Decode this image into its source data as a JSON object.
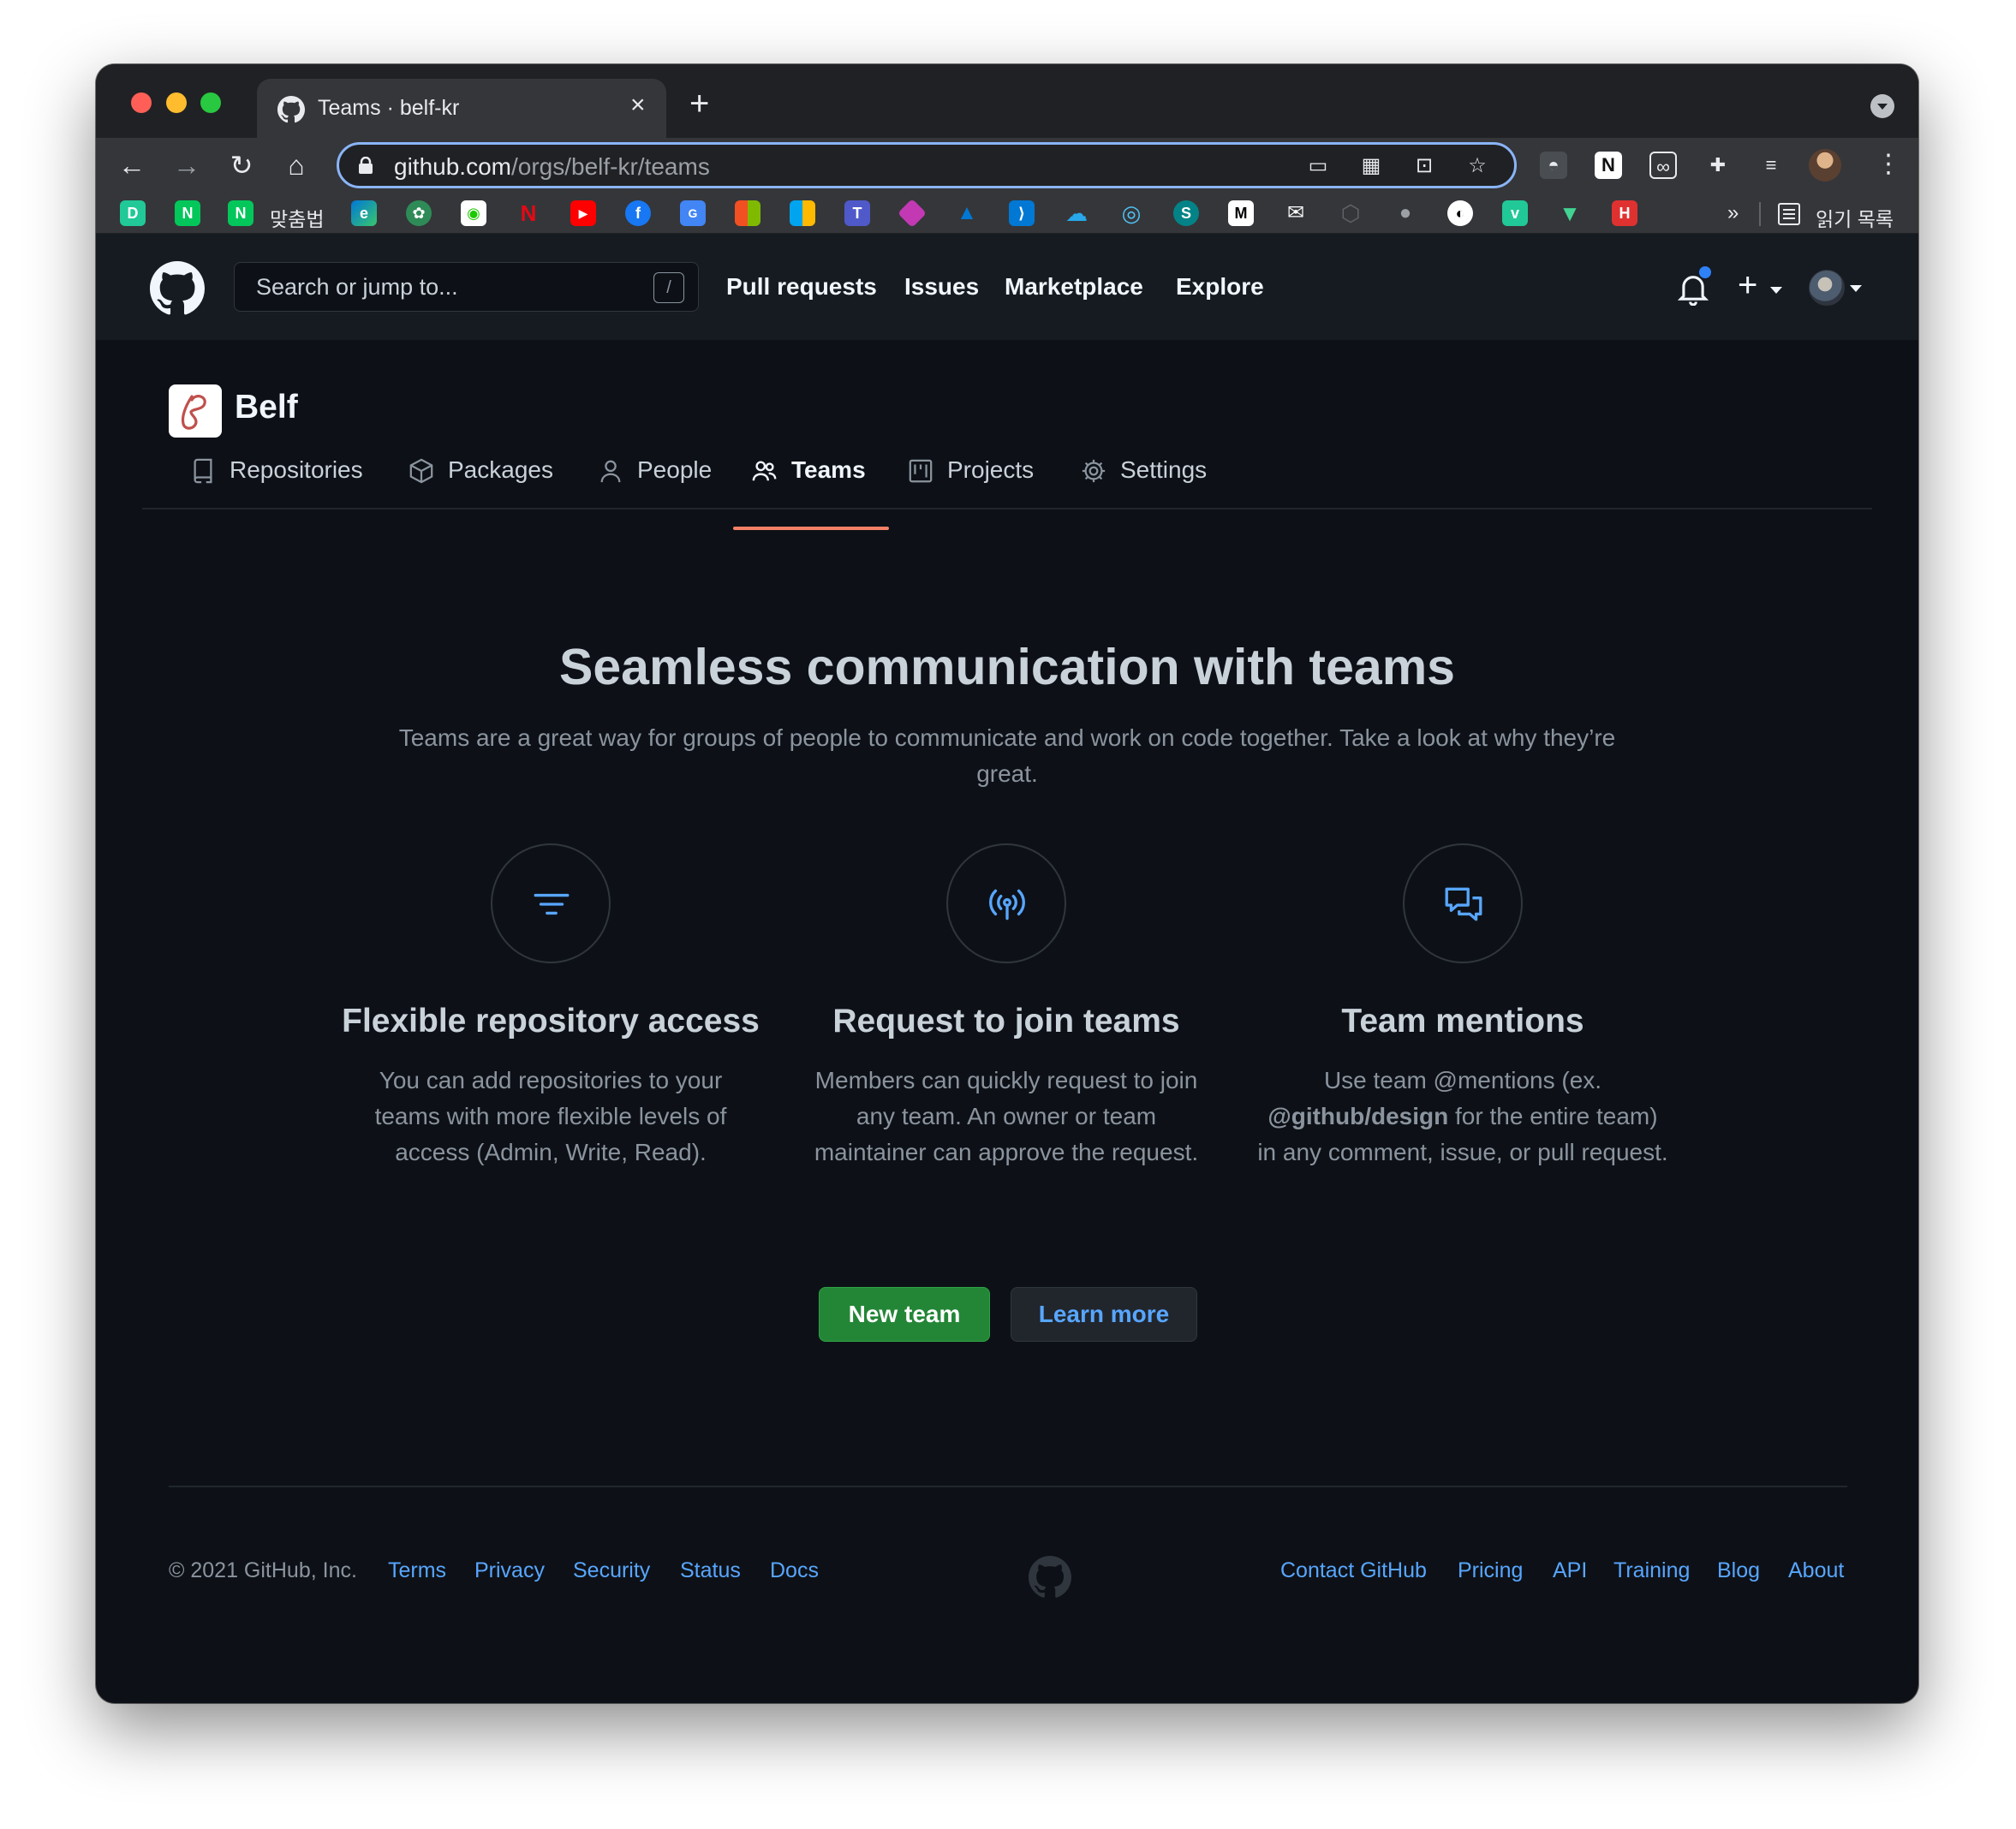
{
  "browser": {
    "tab_title": "Teams · belf-kr",
    "tab_close": "×",
    "new_tab": "+",
    "url_host": "github.com",
    "url_path": "/orgs/belf-kr/teams",
    "bookmarks": {
      "label_1": "맞춤법",
      "more": "»",
      "reading_list": "읽기 목록"
    }
  },
  "github_header": {
    "search_placeholder": "Search or jump to...",
    "search_shortcut": "/",
    "nav": [
      "Pull requests",
      "Issues",
      "Marketplace",
      "Explore"
    ],
    "create_icon": "+"
  },
  "org": {
    "name": "Belf",
    "tabs": [
      "Repositories",
      "Packages",
      "People",
      "Teams",
      "Projects",
      "Settings"
    ],
    "selected_tab": "Teams"
  },
  "hero": {
    "title": "Seamless communication with teams",
    "description": "Teams are a great way for groups of people to communicate and work on code together. Take a look at why they’re great."
  },
  "features": [
    {
      "icon": "filter-icon",
      "title": "Flexible repository access",
      "description": "You can add repositories to your teams with more flexible levels of access (Admin, Write, Read)."
    },
    {
      "icon": "broadcast-icon",
      "title": "Request to join teams",
      "description": "Members can quickly request to join any team. An owner or team maintainer can approve the request."
    },
    {
      "icon": "comment-discussion-icon",
      "title": "Team mentions",
      "description_before": "Use team @mentions (ex.",
      "description_bold": "@github/design",
      "description_after": "for the entire team) in any comment, issue, or pull request."
    }
  ],
  "actions": {
    "new_team": "New team",
    "learn_more": "Learn more"
  },
  "footer": {
    "copyright": "© 2021 GitHub, Inc.",
    "left_links": [
      "Terms",
      "Privacy",
      "Security",
      "Status",
      "Docs"
    ],
    "right_links": [
      "Contact GitHub",
      "Pricing",
      "API",
      "Training",
      "Blog",
      "About"
    ]
  },
  "colors": {
    "background": "#0d1117",
    "header": "#161b22",
    "link": "#58a6ff",
    "primary_button": "#238636",
    "selected_tab_underline": "#f78166",
    "icon_accent": "#58a6ff"
  }
}
